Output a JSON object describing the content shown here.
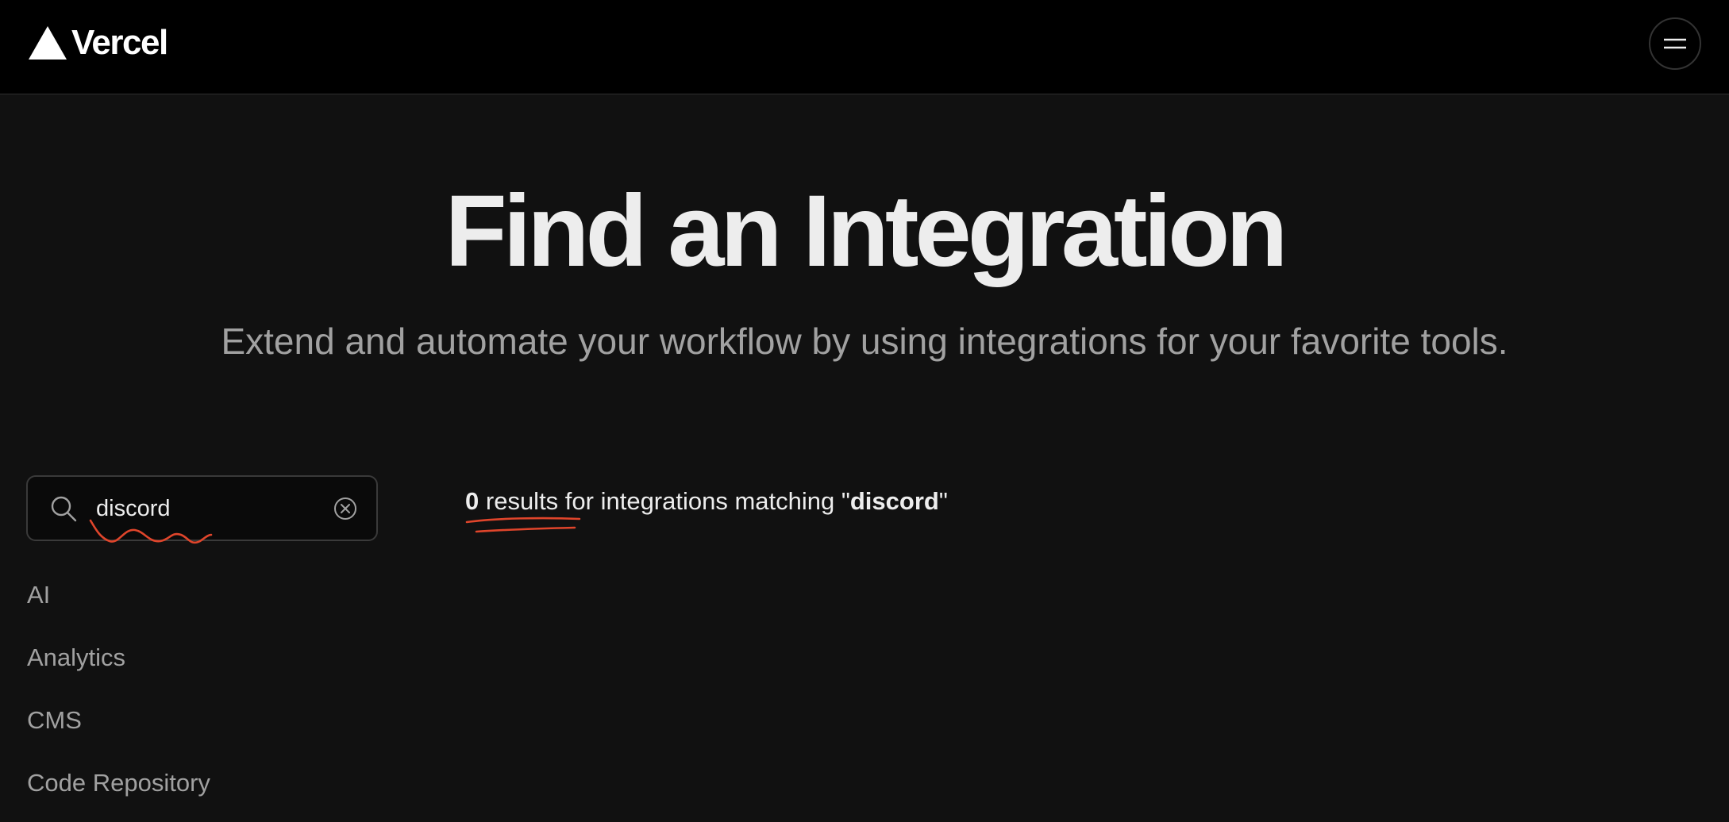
{
  "header": {
    "logo_text": "Vercel",
    "menu_icon": "hamburger-menu-icon"
  },
  "hero": {
    "title": "Find an Integration",
    "subtitle": "Extend and automate your workflow by using integrations for your favorite tools."
  },
  "search": {
    "value": "discord",
    "search_icon": "search-icon",
    "clear_icon": "clear-circle-x-icon"
  },
  "categories": [
    {
      "label": "AI"
    },
    {
      "label": "Analytics"
    },
    {
      "label": "CMS"
    },
    {
      "label": "Code Repository"
    }
  ],
  "results": {
    "count": "0",
    "count_word": "results",
    "prefix": " for integrations matching \"",
    "query": "discord",
    "suffix": "\""
  },
  "colors": {
    "background": "#111111",
    "topbar": "#000000",
    "annotation": "#e0452b",
    "muted_text": "#a1a1a1"
  }
}
